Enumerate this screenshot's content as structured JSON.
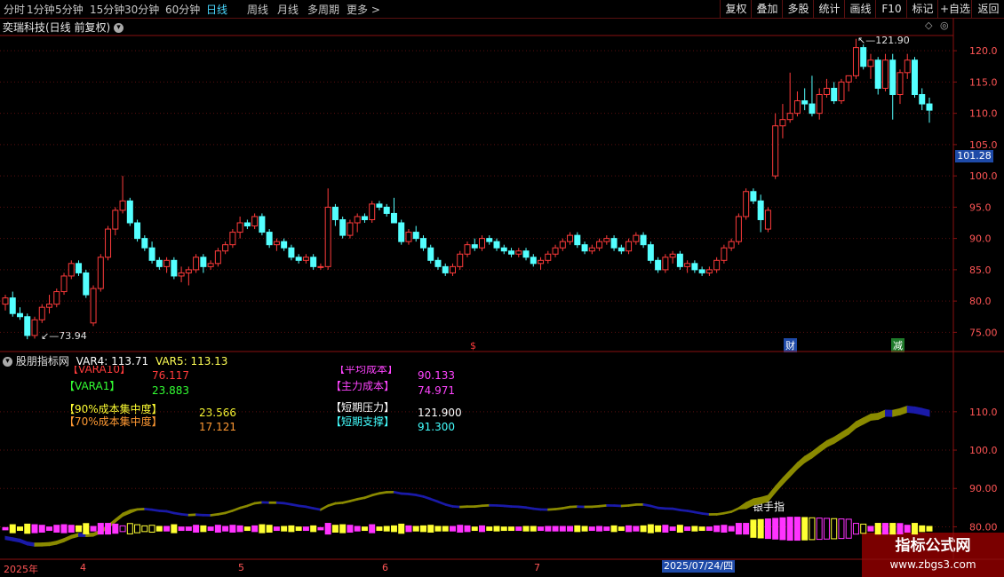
{
  "toolbar": {
    "periods": [
      "分时",
      "1分钟",
      "5分钟",
      "15分钟",
      "30分钟",
      "60分钟",
      "日线",
      "周线",
      "月线",
      "多周期",
      "更多 >"
    ],
    "active_period": "日线",
    "right_buttons": [
      "复权",
      "叠加",
      "多股",
      "统计",
      "画线",
      "F10",
      "标记",
      "+自选",
      "返回"
    ]
  },
  "stock_title": "奕瑞科技(日线 前复权)",
  "price_axis": {
    "ticks": [
      "120.0",
      "115.0",
      "110.0",
      "105.0",
      "100.0",
      "95.0",
      "90.0",
      "85.0",
      "80.0",
      "75.00"
    ],
    "current_price": "101.28"
  },
  "annotations": {
    "high_label": "121.90",
    "low_label": "73.94",
    "marker_s": "$",
    "marker_cai": "财",
    "marker_jian": "减"
  },
  "indicator": {
    "name": "股朋指标网",
    "var4_label": "VAR4: 113.71",
    "var5_label": "VAR5: 113.13",
    "rows": [
      {
        "label": "【VARA10】",
        "value": "76.117"
      },
      {
        "label": "【VARA1】",
        "value": "23.883"
      },
      {
        "label": "【90%成本集中度】",
        "value": "23.566"
      },
      {
        "label": "【70%成本集中度】",
        "value": "17.121"
      },
      {
        "label": "【平均成本】",
        "value": "90.133"
      },
      {
        "label": "【主力成本】",
        "value": "74.971"
      },
      {
        "label": "【短期压力】",
        "value": "121.900"
      },
      {
        "label": "【短期支撑】",
        "value": "91.300"
      }
    ],
    "axis_ticks": [
      "110.0",
      "100.0",
      "90.00",
      "80.00"
    ],
    "bottom_label": "银手指"
  },
  "date_axis": {
    "labels": [
      "2025年",
      "4",
      "5",
      "6",
      "7"
    ],
    "cursor_date": "2025/07/24/四"
  },
  "watermark": {
    "line1": "指标公式网",
    "line2": "www.zbgs3.com"
  },
  "colors": {
    "up": "#ff3b3b",
    "down": "#54ffff",
    "olive": "#8a8a00",
    "blue": "#1a1aa8",
    "magenta": "#ff33ff",
    "yellow": "#ffff33"
  },
  "chart_data": {
    "type": "candlestick",
    "series": [
      {
        "name": "price",
        "ohlc": [
          [
            79.5,
            81.0,
            78.5,
            80.5
          ],
          [
            80.5,
            81.5,
            77.5,
            78.0
          ],
          [
            78.0,
            79.0,
            77.0,
            77.5
          ],
          [
            77.5,
            78.0,
            73.9,
            74.5
          ],
          [
            74.5,
            77.5,
            74.0,
            77.0
          ],
          [
            77.0,
            79.5,
            76.5,
            79.0
          ],
          [
            79.0,
            81.0,
            78.0,
            79.5
          ],
          [
            79.5,
            82.0,
            79.0,
            81.5
          ],
          [
            81.5,
            84.5,
            81.0,
            84.0
          ],
          [
            84.0,
            86.5,
            83.5,
            86.0
          ],
          [
            86.0,
            86.5,
            84.0,
            84.5
          ],
          [
            84.5,
            85.0,
            80.5,
            81.0
          ],
          [
            76.5,
            82.5,
            76.0,
            82.0
          ],
          [
            82.0,
            87.5,
            81.5,
            87.0
          ],
          [
            87.0,
            92.0,
            86.5,
            91.5
          ],
          [
            91.5,
            95.0,
            90.5,
            94.5
          ],
          [
            94.5,
            100.0,
            94.0,
            96.0
          ],
          [
            96.0,
            96.5,
            92.0,
            92.5
          ],
          [
            92.5,
            93.0,
            89.5,
            90.0
          ],
          [
            90.0,
            90.5,
            88.0,
            88.5
          ],
          [
            88.5,
            89.5,
            86.0,
            86.5
          ],
          [
            86.5,
            87.0,
            85.0,
            85.5
          ],
          [
            85.5,
            87.0,
            84.5,
            86.5
          ],
          [
            86.5,
            87.0,
            83.5,
            84.0
          ],
          [
            84.0,
            85.5,
            83.0,
            84.5
          ],
          [
            84.5,
            85.5,
            82.5,
            85.0
          ],
          [
            85.0,
            87.5,
            84.5,
            87.0
          ],
          [
            87.0,
            87.5,
            84.5,
            85.5
          ],
          [
            85.5,
            86.5,
            85.0,
            86.0
          ],
          [
            86.0,
            88.5,
            85.5,
            88.0
          ],
          [
            88.0,
            89.5,
            87.5,
            89.0
          ],
          [
            89.0,
            91.5,
            88.5,
            91.0
          ],
          [
            91.0,
            93.5,
            90.0,
            92.5
          ],
          [
            92.5,
            93.0,
            91.5,
            92.0
          ],
          [
            92.0,
            94.0,
            91.5,
            93.5
          ],
          [
            93.5,
            94.0,
            90.5,
            91.0
          ],
          [
            91.0,
            91.5,
            88.5,
            89.0
          ],
          [
            89.0,
            90.0,
            88.0,
            89.5
          ],
          [
            89.5,
            90.0,
            88.0,
            88.5
          ],
          [
            88.5,
            89.0,
            86.5,
            87.0
          ],
          [
            87.0,
            87.5,
            86.0,
            86.5
          ],
          [
            86.5,
            87.5,
            86.0,
            87.0
          ],
          [
            87.0,
            87.5,
            85.0,
            85.5
          ],
          [
            85.5,
            86.0,
            85.0,
            85.5
          ],
          [
            85.5,
            98.0,
            85.0,
            95.0
          ],
          [
            95.0,
            95.5,
            92.0,
            93.0
          ],
          [
            93.0,
            93.5,
            90.0,
            90.5
          ],
          [
            90.5,
            93.0,
            90.0,
            92.5
          ],
          [
            92.5,
            94.0,
            91.0,
            93.5
          ],
          [
            93.5,
            94.0,
            92.5,
            93.0
          ],
          [
            93.0,
            96.0,
            92.5,
            95.5
          ],
          [
            95.5,
            96.0,
            94.5,
            95.0
          ],
          [
            95.0,
            95.5,
            93.5,
            94.0
          ],
          [
            94.0,
            96.5,
            93.0,
            92.5
          ],
          [
            92.5,
            93.0,
            89.0,
            89.5
          ],
          [
            89.5,
            91.5,
            89.0,
            91.0
          ],
          [
            91.0,
            92.0,
            89.5,
            90.0
          ],
          [
            90.0,
            90.5,
            88.0,
            88.5
          ],
          [
            88.5,
            89.0,
            86.0,
            86.5
          ],
          [
            86.5,
            87.0,
            85.0,
            85.5
          ],
          [
            85.5,
            86.0,
            84.0,
            84.5
          ],
          [
            84.5,
            86.0,
            84.0,
            85.5
          ],
          [
            85.5,
            88.0,
            85.0,
            87.5
          ],
          [
            87.5,
            89.5,
            87.0,
            89.0
          ],
          [
            89.0,
            90.0,
            88.0,
            88.5
          ],
          [
            88.5,
            90.5,
            88.0,
            90.0
          ],
          [
            90.0,
            90.5,
            89.0,
            89.5
          ],
          [
            89.5,
            90.0,
            88.0,
            88.5
          ],
          [
            88.5,
            89.0,
            87.5,
            88.0
          ],
          [
            88.0,
            88.5,
            87.0,
            87.5
          ],
          [
            87.5,
            88.5,
            87.0,
            88.0
          ],
          [
            88.0,
            88.5,
            86.5,
            87.0
          ],
          [
            87.0,
            87.5,
            85.5,
            86.0
          ],
          [
            86.0,
            87.0,
            85.0,
            86.5
          ],
          [
            86.5,
            88.0,
            86.0,
            87.5
          ],
          [
            87.5,
            89.0,
            87.0,
            88.5
          ],
          [
            88.5,
            90.0,
            88.0,
            89.5
          ],
          [
            89.5,
            91.0,
            89.0,
            90.5
          ],
          [
            90.5,
            91.0,
            88.5,
            89.0
          ],
          [
            89.0,
            89.5,
            87.5,
            88.0
          ],
          [
            88.0,
            89.0,
            87.5,
            88.5
          ],
          [
            88.5,
            90.0,
            88.0,
            89.5
          ],
          [
            89.5,
            90.5,
            89.0,
            90.0
          ],
          [
            90.0,
            90.5,
            88.0,
            88.5
          ],
          [
            88.5,
            89.0,
            87.5,
            88.0
          ],
          [
            88.0,
            90.0,
            87.5,
            89.5
          ],
          [
            89.5,
            91.0,
            89.0,
            90.5
          ],
          [
            90.5,
            91.0,
            88.5,
            89.0
          ],
          [
            89.0,
            89.5,
            86.0,
            86.5
          ],
          [
            86.5,
            87.0,
            84.5,
            85.0
          ],
          [
            85.0,
            87.5,
            84.5,
            87.0
          ],
          [
            87.0,
            88.0,
            86.0,
            87.5
          ],
          [
            87.5,
            88.0,
            85.0,
            85.5
          ],
          [
            85.5,
            86.5,
            84.5,
            86.0
          ],
          [
            86.0,
            86.5,
            84.5,
            85.0
          ],
          [
            85.0,
            85.5,
            84.0,
            84.5
          ],
          [
            84.5,
            85.5,
            84.0,
            85.0
          ],
          [
            85.0,
            87.0,
            84.5,
            86.5
          ],
          [
            86.5,
            89.0,
            86.0,
            88.5
          ],
          [
            88.5,
            90.0,
            88.0,
            89.5
          ],
          [
            89.5,
            94.0,
            89.0,
            93.5
          ],
          [
            93.5,
            98.0,
            93.0,
            97.5
          ],
          [
            97.5,
            98.0,
            95.5,
            96.0
          ],
          [
            96.0,
            97.0,
            91.0,
            93.0
          ],
          [
            91.5,
            95.0,
            91.0,
            94.5
          ],
          [
            100.0,
            110.0,
            99.5,
            108.0
          ],
          [
            108.0,
            111.5,
            106.0,
            109.0
          ],
          [
            109.0,
            116.5,
            108.5,
            110.0
          ],
          [
            110.0,
            113.5,
            109.5,
            112.0
          ],
          [
            112.0,
            114.0,
            110.5,
            111.5
          ],
          [
            111.5,
            116.0,
            109.5,
            110.0
          ],
          [
            110.0,
            114.0,
            109.0,
            113.0
          ],
          [
            113.0,
            115.5,
            112.5,
            114.0
          ],
          [
            114.0,
            115.0,
            111.5,
            112.0
          ],
          [
            112.0,
            115.5,
            111.5,
            115.0
          ],
          [
            115.0,
            116.0,
            113.5,
            116.0
          ],
          [
            116.0,
            121.9,
            115.5,
            120.5
          ],
          [
            120.5,
            121.0,
            117.0,
            117.5
          ],
          [
            117.5,
            119.5,
            115.5,
            118.5
          ],
          [
            118.5,
            119.0,
            113.0,
            114.0
          ],
          [
            114.0,
            119.5,
            113.5,
            118.5
          ],
          [
            118.5,
            119.5,
            109.0,
            113.0
          ],
          [
            113.0,
            117.0,
            111.5,
            116.5
          ],
          [
            116.5,
            119.5,
            115.5,
            118.5
          ],
          [
            118.5,
            119.0,
            112.5,
            113.0
          ],
          [
            113.0,
            114.0,
            110.5,
            111.5
          ],
          [
            111.5,
            112.5,
            108.5,
            110.5
          ]
        ]
      }
    ],
    "ylim": [
      72.5,
      123.0
    ]
  }
}
